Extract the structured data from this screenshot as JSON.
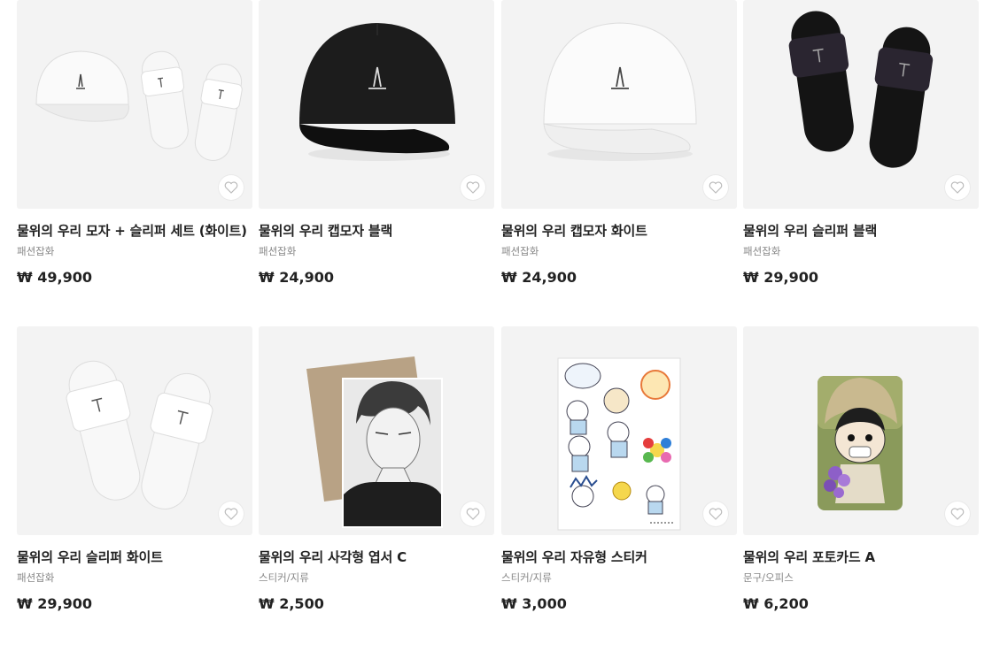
{
  "products": [
    {
      "title": "물위의 우리 모자 + 슬리퍼 세트 (화이트)",
      "category": "패션잡화",
      "price": "₩ 49,900",
      "image_icon": "white-cap-and-slippers-set"
    },
    {
      "title": "물위의 우리 캡모자 블랙",
      "category": "패션잡화",
      "price": "₩ 24,900",
      "image_icon": "black-cap"
    },
    {
      "title": "물위의 우리 캡모자 화이트",
      "category": "패션잡화",
      "price": "₩ 24,900",
      "image_icon": "white-cap"
    },
    {
      "title": "물위의 우리 슬리퍼 블랙",
      "category": "패션잡화",
      "price": "₩ 29,900",
      "image_icon": "black-slippers"
    },
    {
      "title": "물위의 우리 슬리퍼 화이트",
      "category": "패션잡화",
      "price": "₩ 29,900",
      "image_icon": "white-slippers"
    },
    {
      "title": "물위의 우리 사각형 엽서 C",
      "category": "스티커/지류",
      "price": "₩ 2,500",
      "image_icon": "postcard-with-envelope"
    },
    {
      "title": "물위의 우리 자유형 스티커",
      "category": "스티커/지류",
      "price": "₩ 3,000",
      "image_icon": "sticker-sheet"
    },
    {
      "title": "물위의 우리 포토카드 A",
      "category": "문구/오피스",
      "price": "₩ 6,200",
      "image_icon": "photocard"
    }
  ],
  "colors": {
    "thumb_bg": "#f3f3f3",
    "text": "#222222",
    "category_text": "#888888"
  }
}
